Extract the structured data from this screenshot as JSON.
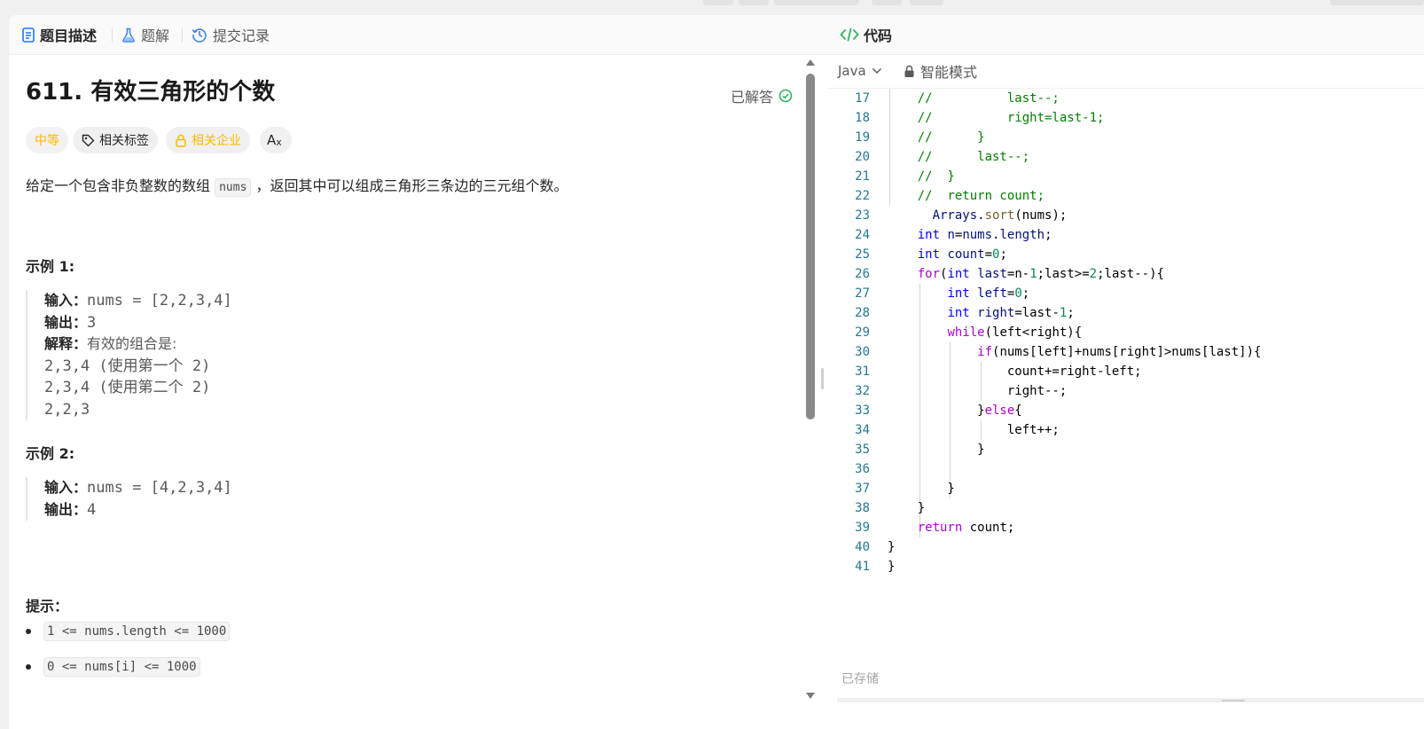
{
  "tabs": [
    {
      "label": "题目描述",
      "icon": "document-icon"
    },
    {
      "label": "题解",
      "icon": "flask-icon"
    },
    {
      "label": "提交记录",
      "icon": "history-icon"
    }
  ],
  "problem": {
    "title": "611. 有效三角形的个数",
    "status": "已解答",
    "difficulty": "中等",
    "tags_label": "相关标签",
    "company_label": "相关企业",
    "translate_label": "A",
    "desc_before": "给定一个包含非负整数的数组 ",
    "desc_code": "nums",
    "desc_after": " ，返回其中可以组成三角形三条边的三元组个数。",
    "example1": {
      "title": "示例 1:",
      "input_label": "输入：",
      "input_value": "nums = [2,2,3,4]",
      "output_label": "输出：",
      "output_value": "3",
      "explain_label": "解释：",
      "explain_text": "有效的组合是: ",
      "lines": [
        "2,3,4 (使用第一个 2)",
        "2,3,4 (使用第二个 2)",
        "2,2,3"
      ]
    },
    "example2": {
      "title": "示例 2:",
      "input_label": "输入：",
      "input_value": "nums = [4,2,3,4]",
      "output_label": "输出：",
      "output_value": "4"
    },
    "hints_title": "提示：",
    "hints": [
      "1 <= nums.length <= 1000",
      "0 <= nums[i] <= 1000"
    ]
  },
  "editor": {
    "title": "代码",
    "language": "Java",
    "mode": "智能模式",
    "saved_status": "已存储",
    "line_numbers": [
      "17",
      "18",
      "19",
      "20",
      "21",
      "22",
      "23",
      "24",
      "25",
      "26",
      "27",
      "28",
      "29",
      "30",
      "31",
      "32",
      "33",
      "34",
      "35",
      "36",
      "37",
      "38",
      "39",
      "40",
      "41"
    ]
  }
}
